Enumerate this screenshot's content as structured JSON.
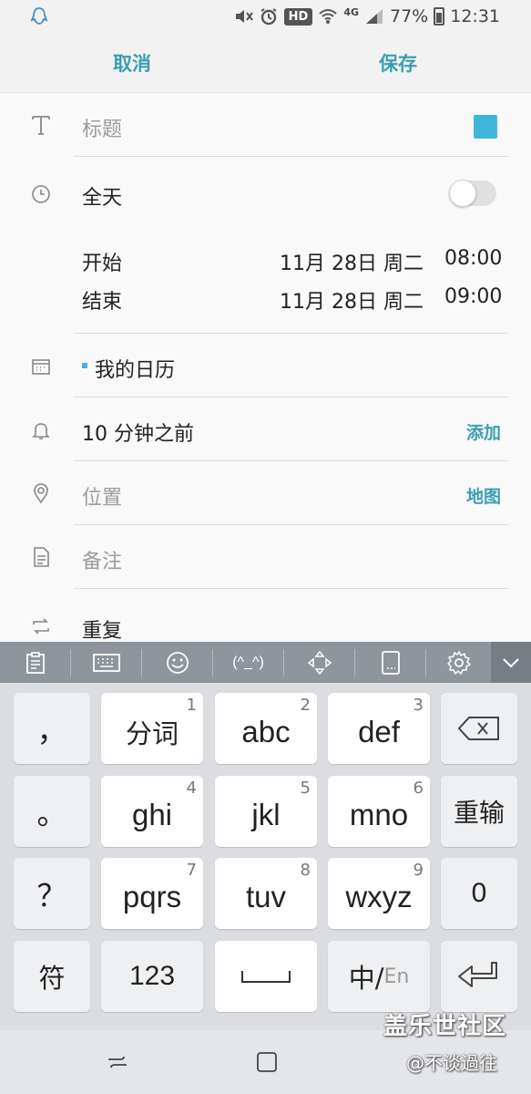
{
  "status_bar": {
    "battery": "77%",
    "time": "12:31",
    "hd": "HD",
    "network": "4G",
    "icons": [
      "qq-icon",
      "mute-icon",
      "alarm-icon",
      "wifi-icon",
      "signal-icon",
      "battery-icon"
    ]
  },
  "action_bar": {
    "cancel_label": "取消",
    "save_label": "保存"
  },
  "form": {
    "title_placeholder": "标题",
    "title_color": "#3fb5dc",
    "all_day_label": "全天",
    "all_day_on": false,
    "start_label": "开始",
    "start_date": "11月 28日 周二",
    "start_time": "08:00",
    "end_label": "结束",
    "end_date": "11月 28日 周二",
    "end_time": "09:00",
    "calendar_name": "我的日历",
    "reminder": "10 分钟之前",
    "reminder_add": "添加",
    "location_placeholder": "位置",
    "map_label": "地图",
    "notes_placeholder": "备注",
    "repeat_label": "重复"
  },
  "keyboard": {
    "toolbar_icons": [
      "clipboard-icon",
      "keyboard-icon",
      "emoji-icon",
      "kaomoji-icon",
      "cursor-move-icon",
      "handwriting-icon",
      "settings-icon",
      "collapse-icon"
    ],
    "kaomoji": "(^_^)",
    "keys": {
      "comma": "，",
      "period": "。",
      "question": "？",
      "symbol": "符",
      "fenci": "分词",
      "fenci_num": "1",
      "abc": "abc",
      "abc_num": "2",
      "def": "def",
      "def_num": "3",
      "ghi": "ghi",
      "ghi_num": "4",
      "jkl": "jkl",
      "jkl_num": "5",
      "mno": "mno",
      "mno_num": "6",
      "pqrs": "pqrs",
      "pqrs_num": "7",
      "tuv": "tuv",
      "tuv_num": "8",
      "wxyz": "wxyz",
      "wxyz_num": "9",
      "retype": "重输",
      "zero": "0",
      "numbers": "123",
      "lang_zh": "中/",
      "lang_en": "En"
    }
  },
  "watermark": {
    "line1": "盖乐世社区",
    "line2": "@不谈過往"
  }
}
